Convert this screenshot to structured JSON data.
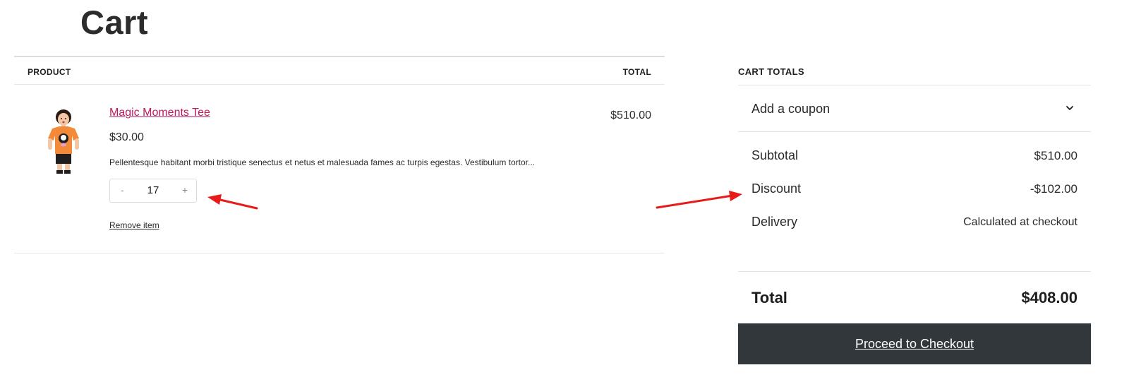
{
  "page": {
    "title": "Cart"
  },
  "cart_table": {
    "header_product": "PRODUCT",
    "header_total": "TOTAL",
    "items": [
      {
        "name": "Magic Moments Tee",
        "price": "$30.00",
        "description": "Pellentesque habitant morbi tristique senectus et netus et malesuada fames ac turpis egestas. Vestibulum tortor...",
        "quantity": "17",
        "qty_minus": "-",
        "qty_plus": "+",
        "remove_label": "Remove item",
        "line_total": "$510.00"
      }
    ]
  },
  "totals": {
    "title": "CART TOTALS",
    "coupon_label": "Add a coupon",
    "subtotal_label": "Subtotal",
    "subtotal_value": "$510.00",
    "discount_label": "Discount",
    "discount_value": "-$102.00",
    "delivery_label": "Delivery",
    "delivery_value": "Calculated at checkout",
    "total_label": "Total",
    "total_value": "$408.00",
    "checkout_label": "Proceed to Checkout"
  },
  "colors": {
    "product_link": "#c2185b",
    "checkout_button": "#32373c",
    "annotation_arrow": "#e81b1b",
    "tee_orange": "#f28a3a"
  },
  "icons": {
    "coupon_toggle": "chevron-down-icon",
    "annotation": "red-arrow-icon"
  }
}
